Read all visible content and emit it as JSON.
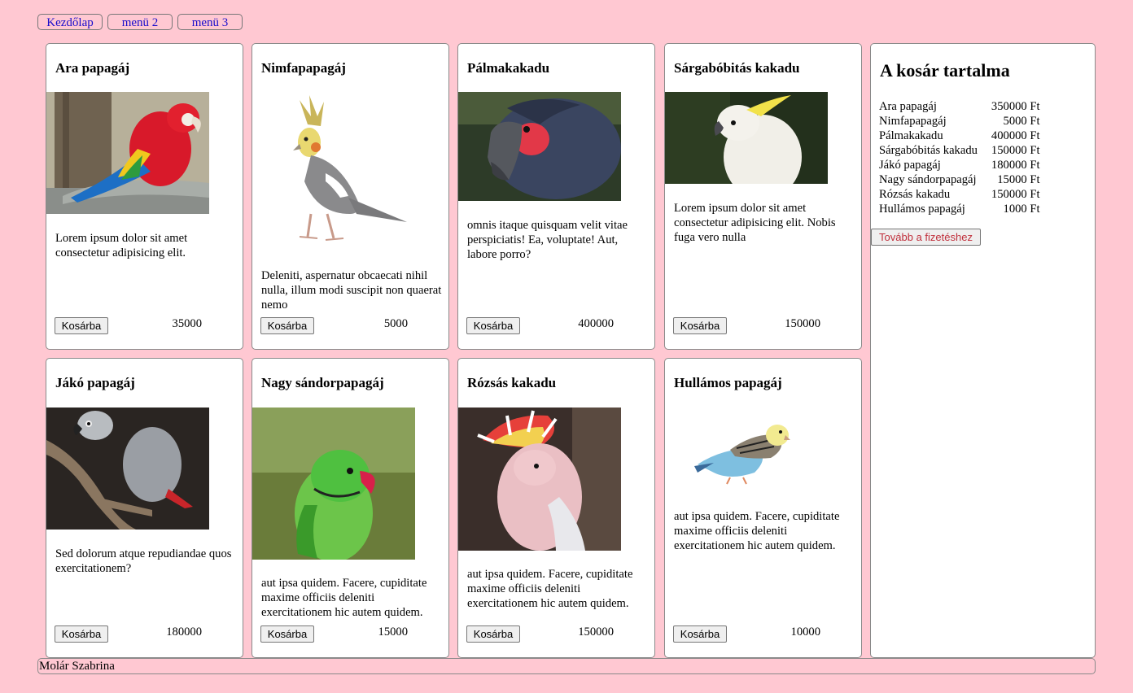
{
  "nav": {
    "items": [
      "Kezdőlap",
      "menü 2",
      "menü 3"
    ]
  },
  "products": [
    {
      "name": "Ara papagáj",
      "description": "Lorem ipsum dolor sit amet consectetur adipisicing elit.",
      "button": "Kosárba",
      "price": "35000"
    },
    {
      "name": "Nimfapapagáj",
      "description": "Deleniti, aspernatur obcaecati nihil nulla, illum modi suscipit non quaerat nemo",
      "button": "Kosárba",
      "price": "5000"
    },
    {
      "name": "Pálmakakadu",
      "description": "omnis itaque quisquam velit vitae perspiciatis! Ea, voluptate! Aut, labore porro?",
      "button": "Kosárba",
      "price": "400000"
    },
    {
      "name": "Sárgabóbitás kakadu",
      "description": "Lorem ipsum dolor sit amet consectetur adipisicing elit. Nobis fuga vero nulla",
      "button": "Kosárba",
      "price": "150000"
    },
    {
      "name": "Jákó papagáj",
      "description": "Sed dolorum atque repudiandae quos exercitationem?",
      "button": "Kosárba",
      "price": "180000"
    },
    {
      "name": "Nagy sándorpapagáj",
      "description": "aut ipsa quidem. Facere, cupiditate maxime officiis deleniti exercitationem hic autem quidem.",
      "button": "Kosárba",
      "price": "15000"
    },
    {
      "name": "Rózsás kakadu",
      "description": "aut ipsa quidem. Facere, cupiditate maxime officiis deleniti exercitationem hic autem quidem.",
      "button": "Kosárba",
      "price": "150000"
    },
    {
      "name": "Hullámos papagáj",
      "description": "aut ipsa quidem. Facere, cupiditate maxime officiis deleniti exercitationem hic autem quidem.",
      "button": "Kosárba",
      "price": "10000"
    }
  ],
  "cart": {
    "title": "A kosár tartalma",
    "items": [
      {
        "name": "Ara papagáj",
        "amount": "350000 Ft"
      },
      {
        "name": "Nimfapapagáj",
        "amount": "5000 Ft"
      },
      {
        "name": "Pálmakakadu",
        "amount": "400000 Ft"
      },
      {
        "name": "Sárgabóbitás kakadu",
        "amount": "150000 Ft"
      },
      {
        "name": "Jákó papagáj",
        "amount": "180000 Ft"
      },
      {
        "name": "Nagy sándorpapagáj",
        "amount": "15000 Ft"
      },
      {
        "name": "Rózsás kakadu",
        "amount": "150000 Ft"
      },
      {
        "name": "Hullámos papagáj",
        "amount": "1000 Ft"
      }
    ],
    "checkout_label": "Tovább a fizetéshez"
  },
  "footer": {
    "author": "Molár Szabrina"
  },
  "colors": {
    "background": "#ffc8d2",
    "link": "#1a0dcc",
    "checkout_text": "#c0303c"
  }
}
